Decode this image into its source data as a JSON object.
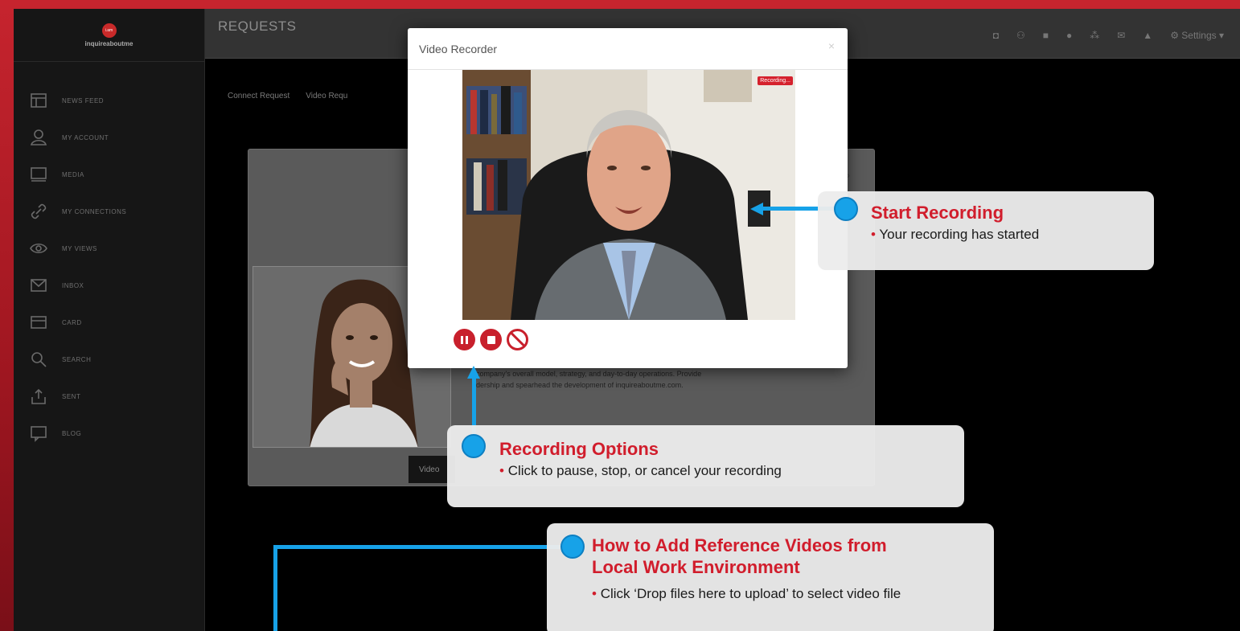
{
  "brand": {
    "logo_mark": "i.am",
    "name": "inquireaboutme"
  },
  "sidebar": {
    "items": [
      {
        "label": "NEWS FEED",
        "icon": "newspaper-icon"
      },
      {
        "label": "MY ACCOUNT",
        "icon": "user-icon"
      },
      {
        "label": "MEDIA",
        "icon": "monitor-icon"
      },
      {
        "label": "MY CONNECTIONS",
        "icon": "link-icon"
      },
      {
        "label": "MY VIEWS",
        "icon": "eye-icon"
      },
      {
        "label": "INBOX",
        "icon": "envelope-icon"
      },
      {
        "label": "CARD",
        "icon": "card-icon"
      },
      {
        "label": "SEARCH",
        "icon": "search-icon"
      },
      {
        "label": "SENT",
        "icon": "share-icon"
      },
      {
        "label": "BLOG",
        "icon": "chat-icon"
      }
    ]
  },
  "topbar": {
    "title": "REQUESTS",
    "icons": [
      "camera-icon",
      "add-user-icon",
      "video-icon",
      "chat-icon",
      "group-icon",
      "mail-icon",
      "bell-icon"
    ],
    "settings_label": "⚙ Settings ▾"
  },
  "subtabs": [
    "Connect Request",
    "Video Requ"
  ],
  "profile": {
    "bio_line1": "company's overall model, strategy, and day-to-day operations. Provide",
    "bio_line2": "dership and spearhead the development of inquireaboutme.com.",
    "video_button": "Video"
  },
  "modal": {
    "title": "Video Recorder",
    "close": "×",
    "recording_badge": "Recording...",
    "controls": [
      "pause-icon",
      "stop-icon",
      "cancel-icon"
    ]
  },
  "callouts": {
    "start": {
      "title": "Start Recording",
      "text": "Your recording has started"
    },
    "options": {
      "title": "Recording Options",
      "text": "Click to pause, stop, or cancel your recording"
    },
    "reference": {
      "title_line1": "How to Add Reference Videos from",
      "title_line2": "Local Work Environment",
      "text": "Click ‘Drop files here to upload’ to select video file"
    }
  },
  "colors": {
    "accent": "#d11d2c",
    "connector": "#17a2e8"
  }
}
